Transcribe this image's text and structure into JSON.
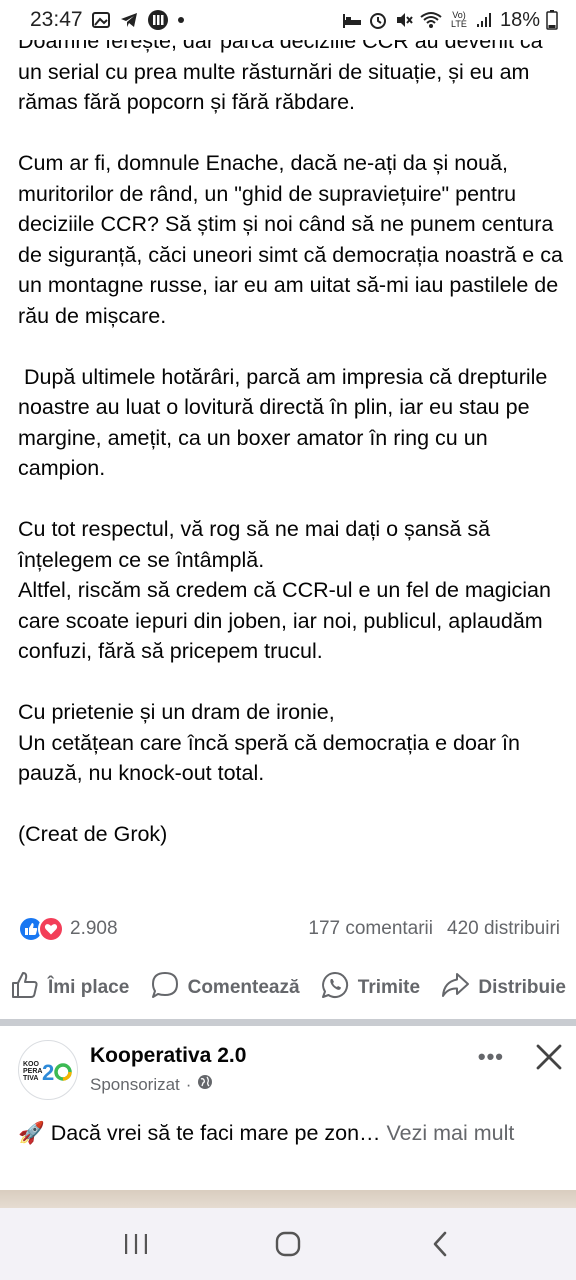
{
  "status_bar": {
    "time": "23:47",
    "network_label": "Vo) LTE",
    "battery": "18%"
  },
  "post": {
    "paragraphs": [
      "Doamne ferește, dar parcă deciziile CCR au devenit ca un serial cu prea multe răsturnări de situație, și eu am rămas fără popcorn și fără răbdare.",
      "Cum ar fi, domnule Enache, dacă ne-ați da și nouă, muritorilor de rând, un \"ghid de supraviețuire\" pentru deciziile CCR? Să știm și noi când să ne punem centura de siguranță, căci uneori simt că democrația noastră e ca un montagne russe, iar eu am uitat să-mi iau pastilele de rău de mișcare.",
      " După ultimele hotărâri, parcă am impresia că drepturile noastre au luat o lovitură directă în plin, iar eu stau pe margine, amețit, ca un boxer amator în ring cu un campion.",
      "Cu tot respectul, vă rog să ne mai dați o șansă să înțelegem ce se întâmplă.",
      "Altfel, riscăm să credem că CCR-ul e un fel de magician care scoate iepuri din joben, iar noi, publicul, aplaudăm confuzi, fără să pricepem trucul.",
      "Cu prietenie și un dram de ironie,",
      "Un cetățean care încă speră că democrația e doar în pauză, nu knock-out total.",
      "(Creat de Grok)"
    ],
    "reaction_count": "2.908",
    "comments": "177 comentarii",
    "shares": "420 distribuiri",
    "actions": {
      "like": "Îmi place",
      "comment": "Comentează",
      "send": "Trimite",
      "share": "Distribuie"
    }
  },
  "ad": {
    "page_name": "Kooperativa 2.0",
    "sponsored": "Sponsorizat",
    "sponsored_sep": "·",
    "logo_text": "KOO PERA TIVA",
    "logo_number": "2.0",
    "more": "•••",
    "text_prefix": "🚀 Dacă vrei să te faci mare pe zon… ",
    "see_more": "Vezi mai mult"
  },
  "colors": {
    "facebook_blue": "#1877f2",
    "love_red": "#f33e58",
    "secondary_text": "#65676b"
  }
}
